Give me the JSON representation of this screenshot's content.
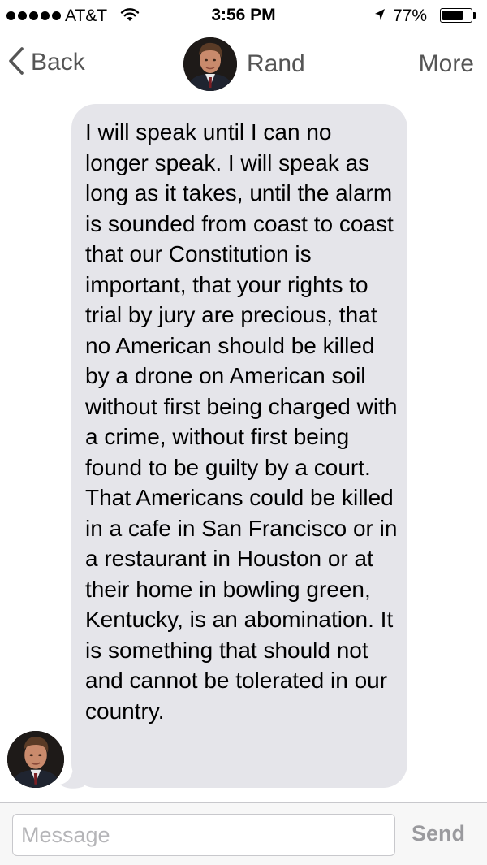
{
  "status_bar": {
    "carrier": "AT&T",
    "time": "3:56 PM",
    "battery_percent_label": "77%",
    "battery_level": 0.77,
    "signal_bars": 5,
    "icons": [
      "signal-dots-icon",
      "wifi-icon",
      "location-arrow-icon",
      "battery-icon"
    ]
  },
  "nav": {
    "back_label": "Back",
    "contact_name": "Rand",
    "more_label": "More"
  },
  "conversation": {
    "messages": [
      {
        "direction": "incoming",
        "sender": "Rand",
        "text": "I will speak until I can no longer speak. I will speak as long as it takes, until the alarm is sounded from coast to coast that our Constitution is important, that your rights to trial by jury are precious, that no American should be killed by a drone on American soil without first being charged with a crime, without first being found to be guilty by a court. That Americans could be killed in a cafe in San Francisco or in a restaurant in Houston or at their home in bowling green, Kentucky, is an abomination. It is something that should not and cannot be tolerated in our country."
      }
    ]
  },
  "compose": {
    "value": "",
    "placeholder": "Message",
    "send_label": "Send"
  },
  "colors": {
    "incoming_bubble": "#e5e5ea",
    "nav_text": "#555555",
    "send_disabled": "#9a9a9e",
    "placeholder": "#b5b5b8"
  }
}
